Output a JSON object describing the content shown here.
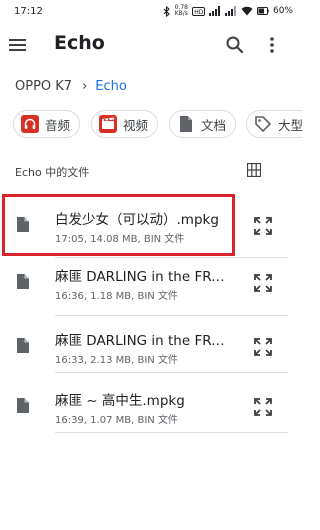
{
  "status_bar": {
    "time": "17:12",
    "speed": "0.78",
    "speed_unit": "KB/s",
    "battery": "60%"
  },
  "app": {
    "title": "Echo"
  },
  "breadcrumb": {
    "root": "OPPO K7",
    "current": "Echo"
  },
  "chips": [
    {
      "label": "音频",
      "icon": "headphones-icon",
      "color": "#d93025"
    },
    {
      "label": "视频",
      "icon": "movie-icon",
      "color": "#d93025"
    },
    {
      "label": "文档",
      "icon": "document-icon",
      "color": "#5f6368"
    },
    {
      "label": "大型",
      "icon": "tag-icon",
      "color": "#5f6368"
    }
  ],
  "section": {
    "title": "Echo 中的文件"
  },
  "files": [
    {
      "name": "白发少女（可以动）.mpkg",
      "meta": "17:05, 14.08 MB, BIN 文件"
    },
    {
      "name": "麻匪 DARLING in the FRANXX.mpkg",
      "meta": "16:36, 1.18 MB, BIN 文件"
    },
    {
      "name": "麻匪 DARLING in the FRANXX.mpkg",
      "meta": "16:33, 2.13 MB, BIN 文件"
    },
    {
      "name": "麻匪 ~ 高中生.mpkg",
      "meta": "16:39, 1.07 MB, BIN 文件"
    }
  ],
  "colors": {
    "accent": "#1a73e8",
    "highlight_box": "#d9232d"
  }
}
